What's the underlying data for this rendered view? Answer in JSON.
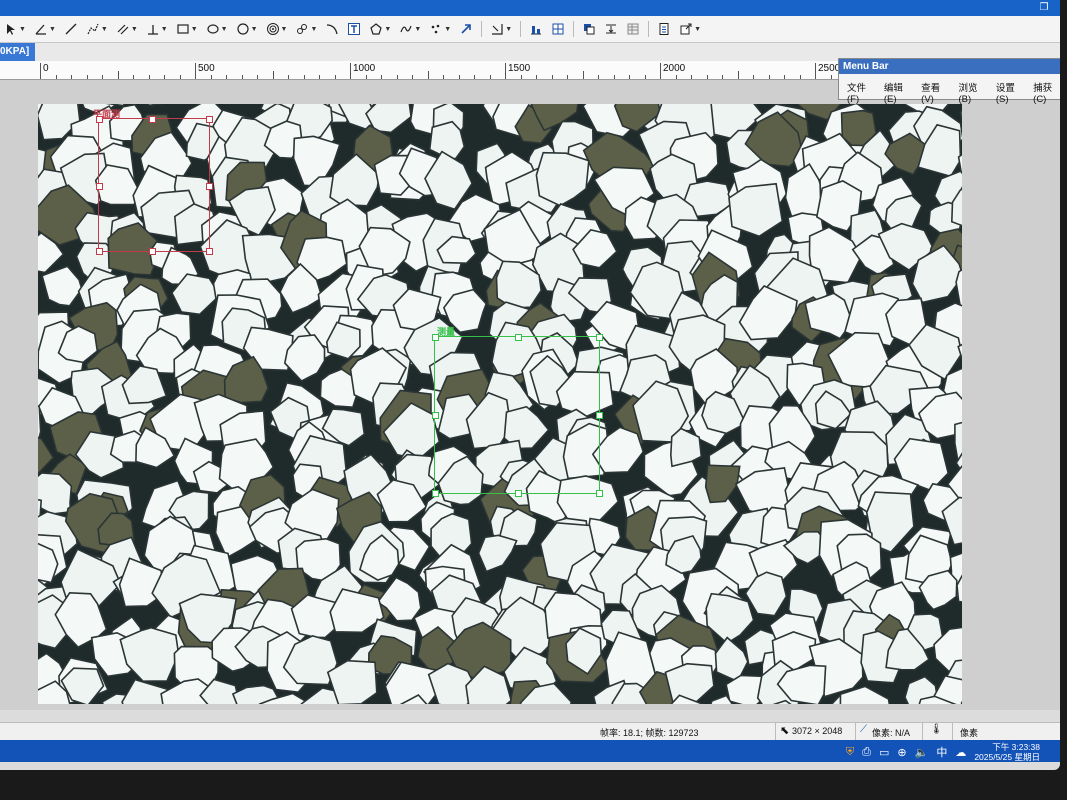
{
  "document_tab": {
    "label": "0KPA]"
  },
  "ruler": {
    "labels": [
      "0",
      "500",
      "1000",
      "1500",
      "2000",
      "2500"
    ]
  },
  "menu_bar": {
    "title": "Menu Bar",
    "items": [
      "文件(F)",
      "编辑(E)",
      "查看(V)",
      "浏览(B)",
      "设置(S)",
      "捕获(C)"
    ]
  },
  "roi_red": {
    "label": "平面测"
  },
  "roi_green": {
    "label": "测量"
  },
  "status": {
    "frame_info": "帧率: 18.1; 帧数: 129723",
    "resolution": "3072 × 2048",
    "pixel_label": "像素: N/A",
    "unit": "像素"
  },
  "taskbar": {
    "ime": "中",
    "time": "下午 3:23:38",
    "date": "2025/5/25 星期日"
  },
  "colors": {
    "accent": "#1763c7",
    "roi_red": "#c33a4a",
    "roi_green": "#35c04a"
  }
}
